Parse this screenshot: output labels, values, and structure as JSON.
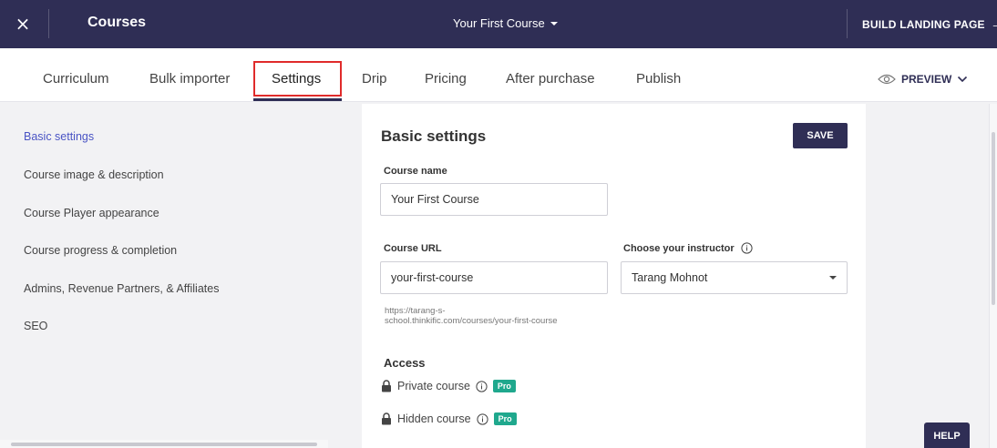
{
  "topbar": {
    "close_glyph": "×",
    "title": "Courses",
    "course_selector": "Your First Course",
    "build_landing_page": "BUILD LANDING PAGE",
    "arrow_glyph": "→"
  },
  "tabs": [
    {
      "label": "Curriculum"
    },
    {
      "label": "Bulk importer"
    },
    {
      "label": "Settings",
      "active": true
    },
    {
      "label": "Drip"
    },
    {
      "label": "Pricing"
    },
    {
      "label": "After purchase"
    },
    {
      "label": "Publish"
    }
  ],
  "preview": {
    "label": "PREVIEW"
  },
  "sidebar": {
    "items": [
      {
        "label": "Basic settings",
        "active": true
      },
      {
        "label": "Course image & description"
      },
      {
        "label": "Course Player appearance"
      },
      {
        "label": "Course progress & completion"
      },
      {
        "label": "Admins, Revenue Partners, & Affiliates"
      },
      {
        "label": "SEO"
      }
    ]
  },
  "panel": {
    "title": "Basic settings",
    "save_label": "SAVE",
    "course_name": {
      "label": "Course name",
      "value": "Your First Course"
    },
    "course_url": {
      "label": "Course URL",
      "value": "your-first-course",
      "hint_line1": "https://tarang-s-",
      "hint_line2": "school.thinkific.com/courses/your-first-course"
    },
    "instructor": {
      "label": "Choose your instructor",
      "value": "Tarang Mohnot"
    },
    "access": {
      "title": "Access",
      "private_label": "Private course",
      "hidden_label": "Hidden course",
      "badge": "Pro"
    }
  },
  "help": {
    "label": "HELP"
  },
  "colors": {
    "topbar_bg": "#2f2e55",
    "active_link": "#4a54c4",
    "highlight_box": "#e02b2b",
    "pro_badge": "#1fa88d"
  }
}
